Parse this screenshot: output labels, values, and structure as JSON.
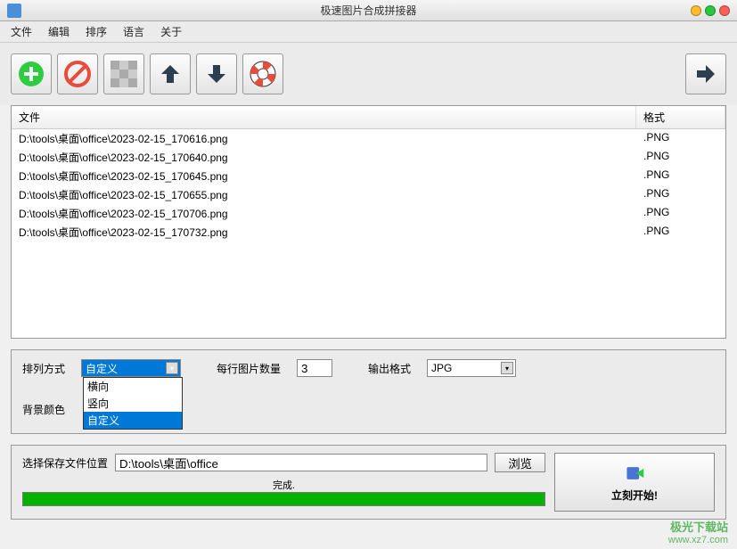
{
  "window": {
    "title": "极速图片合成拼接器"
  },
  "menu": {
    "file": "文件",
    "edit": "编辑",
    "sort": "排序",
    "language": "语言",
    "about": "关于"
  },
  "fileList": {
    "header_file": "文件",
    "header_format": "格式",
    "rows": [
      {
        "path": "D:\\tools\\桌面\\office\\2023-02-15_170616.png",
        "format": ".PNG"
      },
      {
        "path": "D:\\tools\\桌面\\office\\2023-02-15_170640.png",
        "format": ".PNG"
      },
      {
        "path": "D:\\tools\\桌面\\office\\2023-02-15_170645.png",
        "format": ".PNG"
      },
      {
        "path": "D:\\tools\\桌面\\office\\2023-02-15_170655.png",
        "format": ".PNG"
      },
      {
        "path": "D:\\tools\\桌面\\office\\2023-02-15_170706.png",
        "format": ".PNG"
      },
      {
        "path": "D:\\tools\\桌面\\office\\2023-02-15_170732.png",
        "format": ".PNG"
      }
    ]
  },
  "options": {
    "arrange_label": "排列方式",
    "arrange_value": "自定义",
    "arrange_options": {
      "horizontal": "横向",
      "vertical": "竖向",
      "custom": "自定义"
    },
    "per_row_label": "每行图片数量",
    "per_row_value": "3",
    "output_format_label": "输出格式",
    "output_format_value": "JPG",
    "bg_color_label": "背景颜色"
  },
  "save": {
    "label": "选择保存文件位置",
    "path": "D:\\tools\\桌面\\office",
    "browse": "浏览"
  },
  "progress": {
    "status": "完成."
  },
  "start": {
    "label": "立刻开始!"
  },
  "watermark": {
    "text": "极光下载站",
    "url": "www.xz7.com"
  }
}
